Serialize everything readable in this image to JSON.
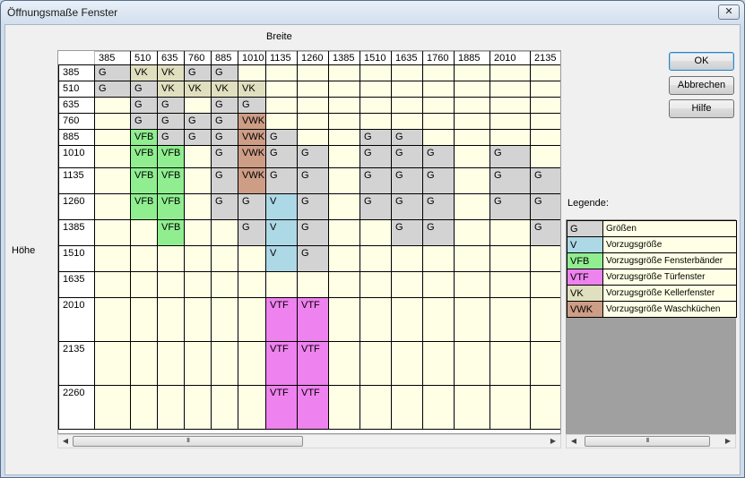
{
  "window": {
    "title": "Öffnungsmaße Fenster",
    "close_label": "✕"
  },
  "axes": {
    "width_label": "Breite",
    "height_label": "Höhe"
  },
  "buttons": {
    "ok": "OK",
    "cancel": "Abbrechen",
    "help": "Hilfe"
  },
  "legend": {
    "title": "Legende:",
    "items": [
      {
        "code": "G",
        "label": "Größen",
        "color": "#d3d3d3"
      },
      {
        "code": "V",
        "label": "Vorzugsgröße",
        "color": "#add8e6"
      },
      {
        "code": "VFB",
        "label": "Vorzugsgröße Fensterbänder",
        "color": "#90ee90"
      },
      {
        "code": "VTF",
        "label": "Vorzugsgröße Türfenster",
        "color": "#ee82ee"
      },
      {
        "code": "VK",
        "label": "Vorzugsgröße Kellerfenster",
        "color": "#e0e0c0"
      },
      {
        "code": "VWK",
        "label": "Vorzugsgröße Waschküchen",
        "color": "#cd9d86"
      }
    ]
  },
  "grid": {
    "col_headers": [
      "385",
      "510",
      "635",
      "760",
      "885",
      "1010",
      "1135",
      "1260",
      "1385",
      "1510",
      "1635",
      "1760",
      "1885",
      "2010",
      "2135"
    ],
    "rows": [
      {
        "h": "385",
        "cells": [
          "G",
          "VK",
          "VK",
          "G",
          "G",
          "",
          "",
          "",
          "",
          "",
          "",
          "",
          "",
          "",
          ""
        ]
      },
      {
        "h": "510",
        "cells": [
          "G",
          "G",
          "VK",
          "VK",
          "VK",
          "VK",
          "",
          "",
          "",
          "",
          "",
          "",
          "",
          "",
          ""
        ]
      },
      {
        "h": "635",
        "cells": [
          "",
          "G",
          "G",
          "",
          "G",
          "G",
          "",
          "",
          "",
          "",
          "",
          "",
          "",
          "",
          ""
        ]
      },
      {
        "h": "760",
        "cells": [
          "",
          "G",
          "G",
          "G",
          "G",
          "VWK",
          "",
          "",
          "",
          "",
          "",
          "",
          "",
          "",
          ""
        ]
      },
      {
        "h": "885",
        "cells": [
          "",
          "VFB",
          "G",
          "G",
          "G",
          "VWK",
          "G",
          "",
          "",
          "G",
          "G",
          "",
          "",
          "",
          ""
        ]
      },
      {
        "h": "1010",
        "cells": [
          "",
          "VFB",
          "VFB",
          "",
          "G",
          "VWK",
          "G",
          "G",
          "",
          "G",
          "G",
          "G",
          "",
          "G",
          ""
        ]
      },
      {
        "h": "1135",
        "cells": [
          "",
          "VFB",
          "VFB",
          "",
          "G",
          "VWK",
          "G",
          "G",
          "",
          "G",
          "G",
          "G",
          "",
          "G",
          "G"
        ]
      },
      {
        "h": "1260",
        "cells": [
          "",
          "VFB",
          "VFB",
          "",
          "G",
          "G",
          "V",
          "G",
          "",
          "G",
          "G",
          "G",
          "",
          "G",
          "G"
        ]
      },
      {
        "h": "1385",
        "cells": [
          "",
          "",
          "VFB",
          "",
          "",
          "G",
          "V",
          "G",
          "",
          "",
          "G",
          "G",
          "",
          "",
          "G"
        ]
      },
      {
        "h": "1510",
        "cells": [
          "",
          "",
          "",
          "",
          "",
          "",
          "V",
          "G",
          "",
          "",
          "",
          "",
          "",
          "",
          ""
        ]
      },
      {
        "h": "1635",
        "cells": [
          "",
          "",
          "",
          "",
          "",
          "",
          "",
          "",
          "",
          "",
          "",
          "",
          "",
          "",
          ""
        ]
      },
      {
        "h": "2010",
        "cells": [
          "",
          "",
          "",
          "",
          "",
          "",
          "VTF",
          "VTF",
          "",
          "",
          "",
          "",
          "",
          "",
          ""
        ]
      },
      {
        "h": "2135",
        "cells": [
          "",
          "",
          "",
          "",
          "",
          "",
          "VTF",
          "VTF",
          "",
          "",
          "",
          "",
          "",
          "",
          ""
        ]
      },
      {
        "h": "2260",
        "cells": [
          "",
          "",
          "",
          "",
          "",
          "",
          "VTF",
          "VTF",
          "",
          "",
          "",
          "",
          "",
          "",
          ""
        ]
      }
    ]
  },
  "scrollbars": {
    "thumb_glyph": "III"
  }
}
